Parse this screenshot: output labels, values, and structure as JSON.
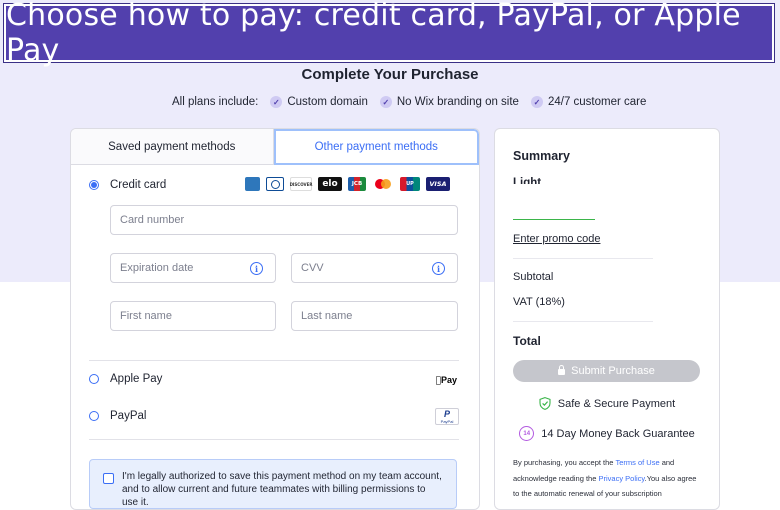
{
  "banner": {
    "text": "Choose how to pay: credit card, PayPal, or Apple Pay"
  },
  "page": {
    "title": "Complete Your Purchase",
    "includes_label": "All plans include:",
    "includes": [
      "Custom domain",
      "No Wix branding on site",
      "24/7 customer care"
    ]
  },
  "tabs": {
    "saved": "Saved payment methods",
    "other": "Other payment methods"
  },
  "methods": {
    "credit_card": "Credit card",
    "apple_pay": "Apple Pay",
    "paypal": "PayPal",
    "apple_pay_logo": "Pay",
    "paypal_logo_p": "P",
    "paypal_logo_text": "PayPal"
  },
  "card_logos": [
    {
      "name": "amex-logo",
      "text": "AMEX",
      "bg": "#2e77bb"
    },
    {
      "name": "diners-logo",
      "text": "D",
      "bg": "#0e4c96"
    },
    {
      "name": "discover-logo",
      "text": "DISCOVER",
      "bg": "#ffffff"
    },
    {
      "name": "elo-logo",
      "text": "elo",
      "bg": "#111111"
    },
    {
      "name": "jcb-logo",
      "text": "JCB",
      "bg": "#1b8a3c"
    },
    {
      "name": "mastercard-logo",
      "text": "",
      "bg": "#ffffff"
    },
    {
      "name": "unionpay-logo",
      "text": "UP",
      "bg": "#d6182b"
    },
    {
      "name": "visa-logo",
      "text": "VISA",
      "bg": "#1a1f71"
    }
  ],
  "form": {
    "card_number_placeholder": "Card number",
    "expiration_placeholder": "Expiration date",
    "cvv_placeholder": "CVV",
    "first_name_placeholder": "First name",
    "last_name_placeholder": "Last name",
    "info_glyph": "i"
  },
  "consent_text": "I'm legally authorized to save this payment method on my team account, and to allow current and future teammates with billing permissions to use it.",
  "summary": {
    "title": "Summary",
    "plan": "Light",
    "promo": "Enter promo code",
    "subtotal": "Subtotal",
    "vat": "VAT (18%)",
    "total": "Total",
    "submit": "Submit Purchase",
    "secure": "Safe & Secure Payment",
    "money_back": "14 Day Money Back Guarantee",
    "money_back_badge": "14",
    "legal_1": "By purchasing, you accept the ",
    "terms_link": "Terms of Use",
    "legal_2": " and acknowledge reading the ",
    "privacy_link": "Privacy Policy",
    "legal_3": ".You also agree to the automatic renewal of your subscription"
  },
  "colors": {
    "brand": "#5240ad",
    "accent": "#3b6ef5",
    "secure_green": "#3bb54a",
    "money_back_purple": "#b35be0"
  }
}
